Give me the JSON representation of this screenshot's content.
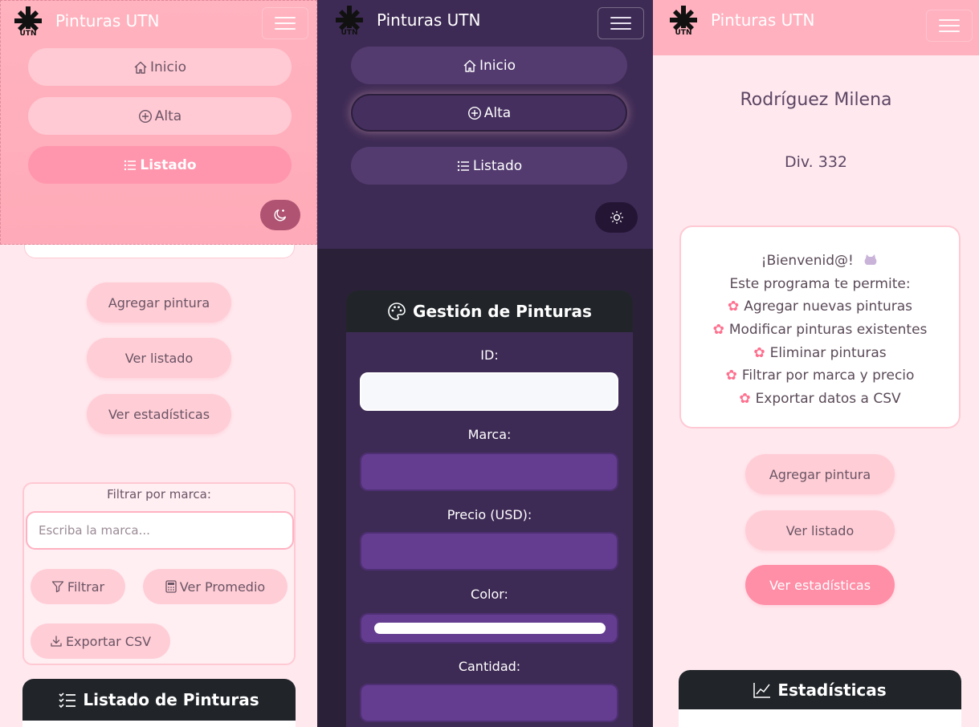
{
  "brand": {
    "name": "Pinturas UTN",
    "logo_text": "UTN"
  },
  "nav": {
    "home": "Inicio",
    "add": "Alta",
    "list": "Listado"
  },
  "panel_left": {
    "actions": [
      "Agregar pintura",
      "Ver listado",
      "Ver estadísticas"
    ],
    "filter": {
      "label": "Filtrar por marca:",
      "placeholder": "Escriba la marca...",
      "filter_button": "Filtrar",
      "average_button": "Ver Promedio",
      "export_button": "Exportar CSV"
    },
    "list_title": "Listado de Pinturas"
  },
  "panel_middle": {
    "form_title": "Gestión de Pinturas",
    "fields": {
      "id": "ID:",
      "brand": "Marca:",
      "price": "Precio (USD):",
      "color": "Color:",
      "quantity": "Cantidad:"
    }
  },
  "panel_right": {
    "student": "Rodríguez Milena",
    "division": "Div. 332",
    "welcome": {
      "greeting": "¡Bienvenid@!",
      "intro": "Este programa te permite:",
      "features": [
        "Agregar nuevas pinturas",
        "Modificar pinturas existentes",
        "Eliminar pinturas",
        "Filtrar por marca y precio",
        "Exportar datos a CSV"
      ]
    },
    "actions": [
      "Agregar pintura",
      "Ver listado",
      "Ver estadísticas"
    ],
    "stats_title": "Estadísticas"
  },
  "colors": {
    "pink_bg": "#ffe9ef",
    "pink_nav": "#ffb1bf",
    "pink_accent": "#ff8ea7",
    "dark_bg": "#2a2038",
    "dark_nav": "#3e2b55",
    "input_purple": "#643d91",
    "card_header": "#212529"
  }
}
